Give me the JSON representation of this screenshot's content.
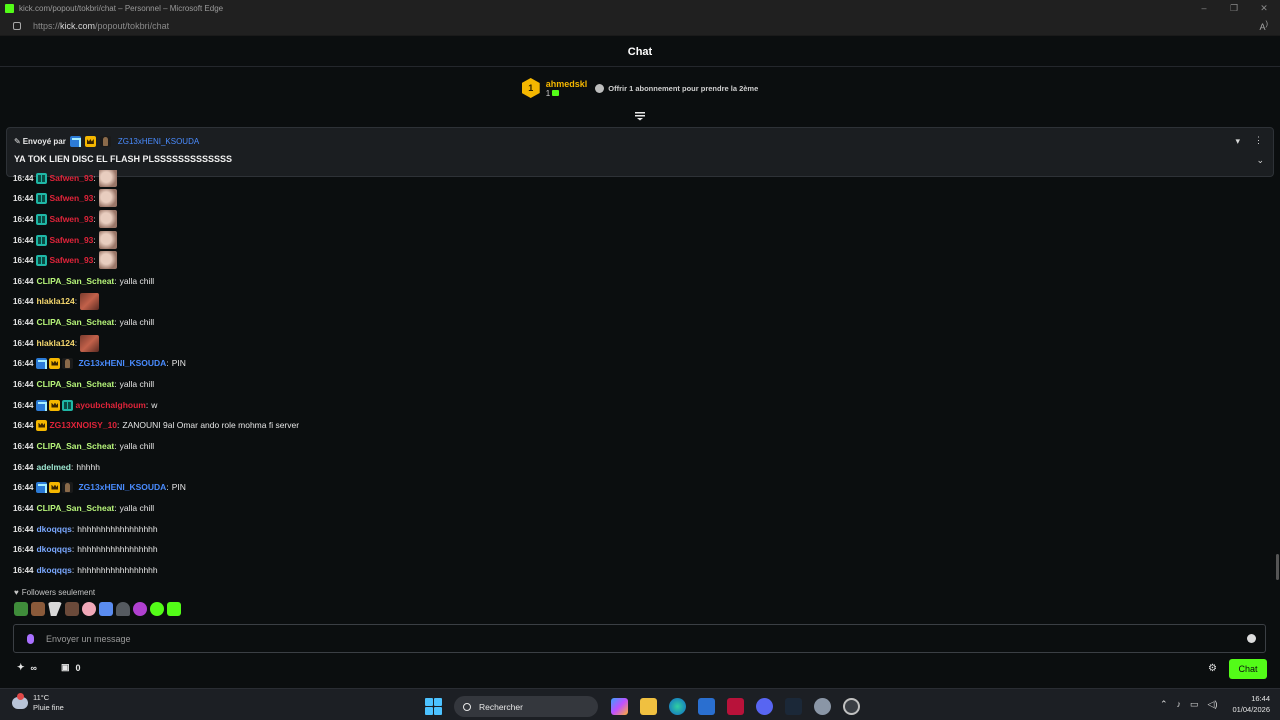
{
  "window": {
    "title": "kick.com/popout/tokbri/chat – Personnel – Microsoft Edge",
    "minimize": "–",
    "restore": "❐",
    "close": "✕"
  },
  "address": {
    "prefix": "https://",
    "domain": "kick.com",
    "path": "/popout/tokbri/chat",
    "read_aloud": "Aͅ"
  },
  "chat": {
    "title": "Chat"
  },
  "subs": {
    "rank": "1",
    "gifter_name": "ahmedskl",
    "gift_count": "1",
    "offer_text": "Offrir 1 abonnement pour prendre la 2ème"
  },
  "pinned": {
    "sent_by": "Envoyé par",
    "username": "ZG13xHENI_KSOUDA",
    "message": "YA TOK LIEN DISC EL FLASH PLSSSSSSSSSSSSS",
    "user_color": "#4a8cff"
  },
  "messages": [
    {
      "time": "16:44",
      "user": "Safwen_93",
      "color": "#e0243a",
      "badges": [
        "sub"
      ],
      "text": "",
      "emote": "cat"
    },
    {
      "time": "16:44",
      "user": "Safwen_93",
      "color": "#e0243a",
      "badges": [
        "sub"
      ],
      "text": "",
      "emote": "cat"
    },
    {
      "time": "16:44",
      "user": "Safwen_93",
      "color": "#e0243a",
      "badges": [
        "sub"
      ],
      "text": "",
      "emote": "cat"
    },
    {
      "time": "16:44",
      "user": "Safwen_93",
      "color": "#e0243a",
      "badges": [
        "sub"
      ],
      "text": "",
      "emote": "cat"
    },
    {
      "time": "16:44",
      "user": "Safwen_93",
      "color": "#e0243a",
      "badges": [
        "sub"
      ],
      "text": "",
      "emote": "cat"
    },
    {
      "time": "16:44",
      "user": "CLIPA_San_Scheat",
      "color": "#b7f57a",
      "badges": [],
      "text": "yalla chill",
      "emote": ""
    },
    {
      "time": "16:44",
      "user": "hlakla124",
      "color": "#f5d76e",
      "badges": [],
      "text": "",
      "emote": "face"
    },
    {
      "time": "16:44",
      "user": "CLIPA_San_Scheat",
      "color": "#b7f57a",
      "badges": [],
      "text": "yalla chill",
      "emote": ""
    },
    {
      "time": "16:44",
      "user": "hlakla124",
      "color": "#f5d76e",
      "badges": [],
      "text": "",
      "emote": "face"
    },
    {
      "time": "16:44",
      "user": "ZG13xHENI_KSOUDA",
      "color": "#4a8cff",
      "badges": [
        "og",
        "crown",
        "founder"
      ],
      "text": "PIN",
      "emote": ""
    },
    {
      "time": "16:44",
      "user": "CLIPA_San_Scheat",
      "color": "#b7f57a",
      "badges": [],
      "text": "yalla chill",
      "emote": ""
    },
    {
      "time": "16:44",
      "user": "ayoubchalghoum",
      "color": "#e0243a",
      "badges": [
        "og",
        "crown",
        "sub"
      ],
      "text": "w",
      "emote": ""
    },
    {
      "time": "16:44",
      "user": "ZG13XNOISY_10",
      "color": "#e0243a",
      "badges": [
        "crown"
      ],
      "text": "ZANOUNI 9al Omar ando role mohma fi server",
      "emote": ""
    },
    {
      "time": "16:44",
      "user": "CLIPA_San_Scheat",
      "color": "#b7f57a",
      "badges": [],
      "text": "yalla chill",
      "emote": ""
    },
    {
      "time": "16:44",
      "user": "adelmed",
      "color": "#9ee6d0",
      "badges": [],
      "text": "hhhhh",
      "emote": ""
    },
    {
      "time": "16:44",
      "user": "ZG13xHENI_KSOUDA",
      "color": "#4a8cff",
      "badges": [
        "og",
        "crown",
        "founder"
      ],
      "text": "PIN",
      "emote": ""
    },
    {
      "time": "16:44",
      "user": "CLIPA_San_Scheat",
      "color": "#b7f57a",
      "badges": [],
      "text": "yalla chill",
      "emote": ""
    },
    {
      "time": "16:44",
      "user": "dkoqqqs",
      "color": "#7aa8ff",
      "badges": [],
      "text": "hhhhhhhhhhhhhhhhh",
      "emote": ""
    },
    {
      "time": "16:44",
      "user": "dkoqqqs",
      "color": "#7aa8ff",
      "badges": [],
      "text": "hhhhhhhhhhhhhhhhh",
      "emote": ""
    },
    {
      "time": "16:44",
      "user": "dkoqqqs",
      "color": "#7aa8ff",
      "badges": [],
      "text": "hhhhhhhhhhhhhhhhh",
      "emote": ""
    }
  ],
  "followers_only": "Followers seulement",
  "quick_emotes": [
    "#3f8c3a",
    "#8a5a3a",
    "#e0e0e0",
    "#6b4a3a",
    "#f0a8b8",
    "#5a8cf0",
    "#555a60",
    "#b040d0",
    "#53fc18",
    "#53fc18"
  ],
  "input": {
    "placeholder": "Envoyer un message"
  },
  "footer": {
    "points": "∞",
    "gifts": "0",
    "send_label": "Chat"
  },
  "taskbar": {
    "temperature": "11°C",
    "weather": "Pluie fine",
    "search_label": "Rechercher",
    "time": "16:44",
    "date": "01/04/2026"
  },
  "colors": {
    "accent": "#53fc18",
    "background": "#0b0e0f"
  }
}
